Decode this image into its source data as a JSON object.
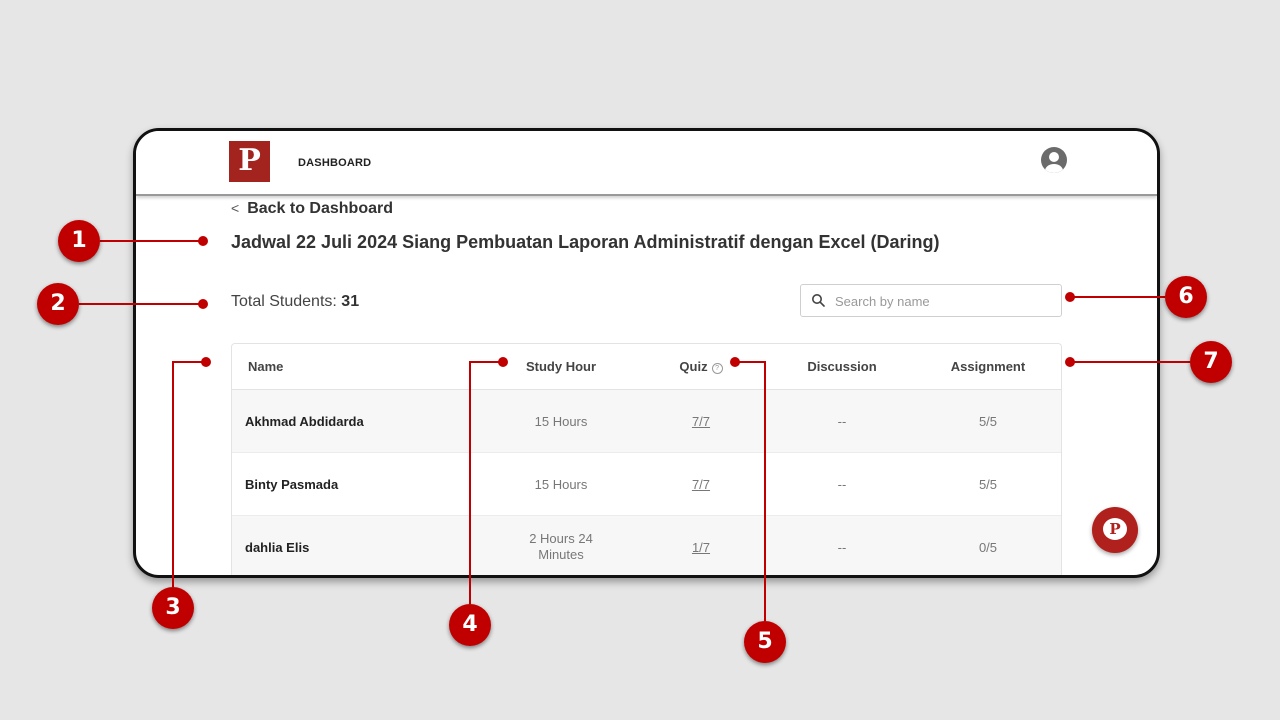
{
  "header": {
    "logo_letter": "P",
    "nav_label": "DASHBOARD"
  },
  "back_link": "Back to Dashboard",
  "page_title": "Jadwal 22 Juli 2024 Siang Pembuatan Laporan Administratif dengan Excel (Daring)",
  "stats": {
    "total_label": "Total Students:",
    "total_value": "31"
  },
  "search": {
    "placeholder": "Search by name",
    "value": ""
  },
  "table": {
    "columns": [
      "Name",
      "Study Hour",
      "Quiz",
      "Discussion",
      "Assignment"
    ],
    "quiz_help_glyph": "?",
    "rows": [
      {
        "name": "Akhmad Abdidarda",
        "study": "15 Hours",
        "quiz": "7/7",
        "discussion": "--",
        "assignment": "5/5"
      },
      {
        "name": "Binty Pasmada",
        "study": "15 Hours",
        "quiz": "7/7",
        "discussion": "--",
        "assignment": "5/5"
      },
      {
        "name": "dahlia Elis",
        "study": "2 Hours 24 Minutes",
        "quiz": "1/7",
        "discussion": "--",
        "assignment": "0/5"
      }
    ]
  },
  "chat_widget": {
    "letter": "P"
  },
  "annotations": [
    "1",
    "2",
    "3",
    "4",
    "5",
    "6",
    "7"
  ],
  "colors": {
    "brand": "#a3241e",
    "annotation": "#c00000"
  }
}
